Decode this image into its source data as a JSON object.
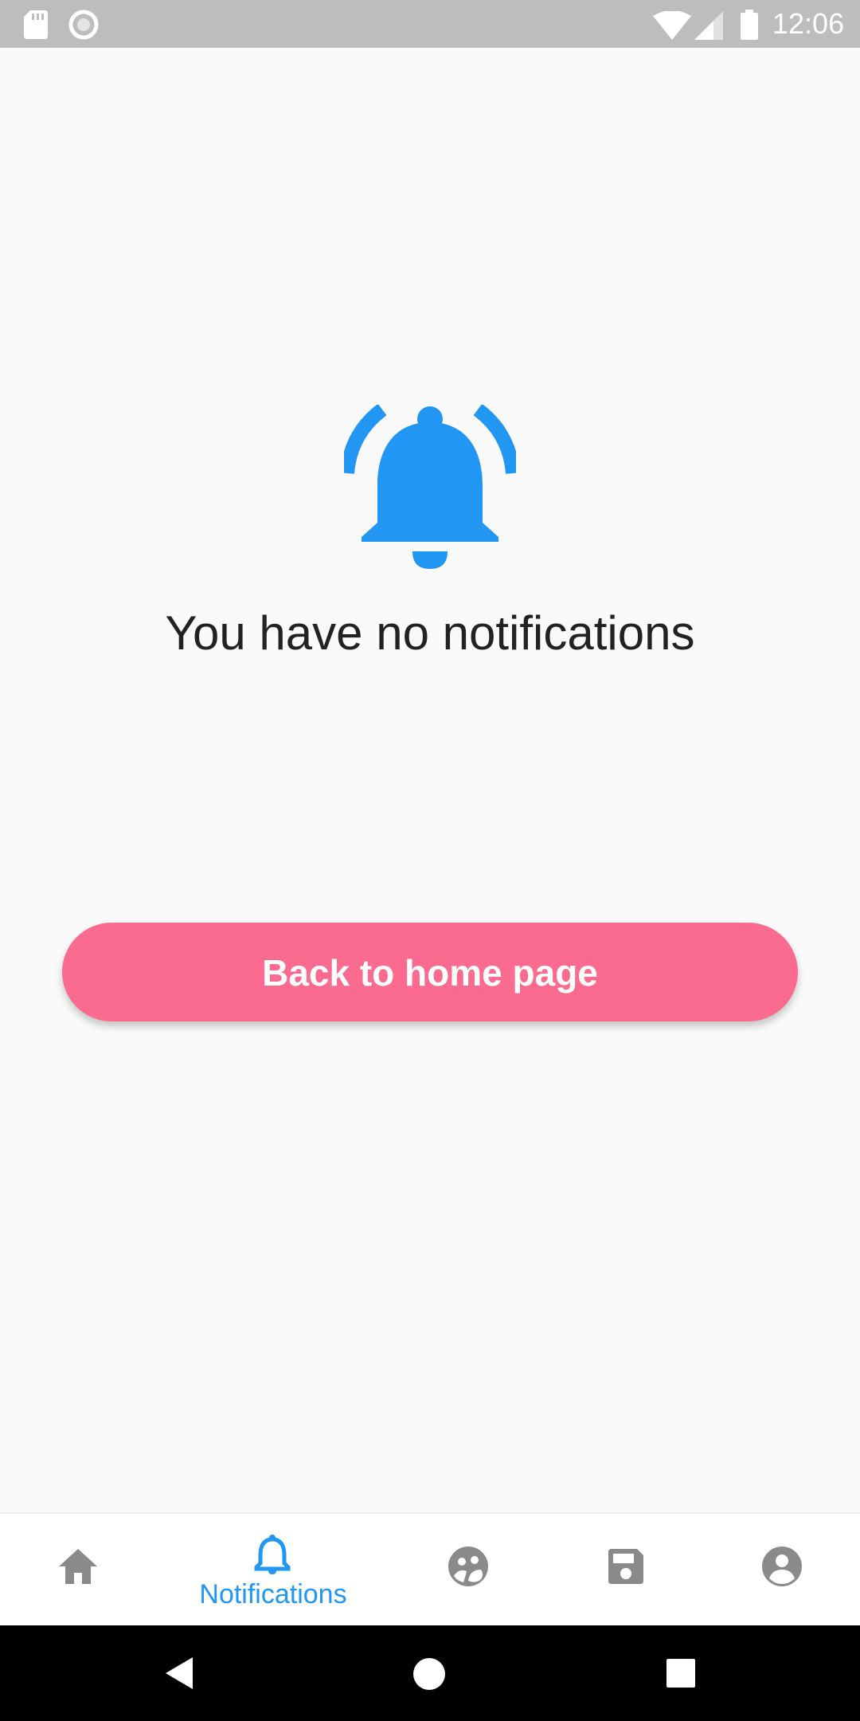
{
  "status_bar": {
    "time": "12:06",
    "icons": [
      "sd-card-icon",
      "record-icon",
      "wifi-icon",
      "signal-icon",
      "battery-icon"
    ]
  },
  "main": {
    "icon": "bell-ringing-icon",
    "message": "You have no notifications",
    "back_button_label": "Back to home page"
  },
  "bottom_nav": {
    "items": [
      {
        "icon": "home-icon",
        "label": "",
        "active": false
      },
      {
        "icon": "bell-icon",
        "label": "Notifications",
        "active": true
      },
      {
        "icon": "community-icon",
        "label": "",
        "active": false
      },
      {
        "icon": "save-icon",
        "label": "",
        "active": false
      },
      {
        "icon": "account-icon",
        "label": "",
        "active": false
      }
    ]
  },
  "system_nav": {
    "buttons": [
      "back-icon",
      "home-circle-icon",
      "recents-icon"
    ]
  },
  "colors": {
    "accent_blue": "#2196f3",
    "button_pink": "#fb6a8f",
    "inactive_gray": "#8a8a8a",
    "status_bar_gray": "#bdbdbd"
  }
}
